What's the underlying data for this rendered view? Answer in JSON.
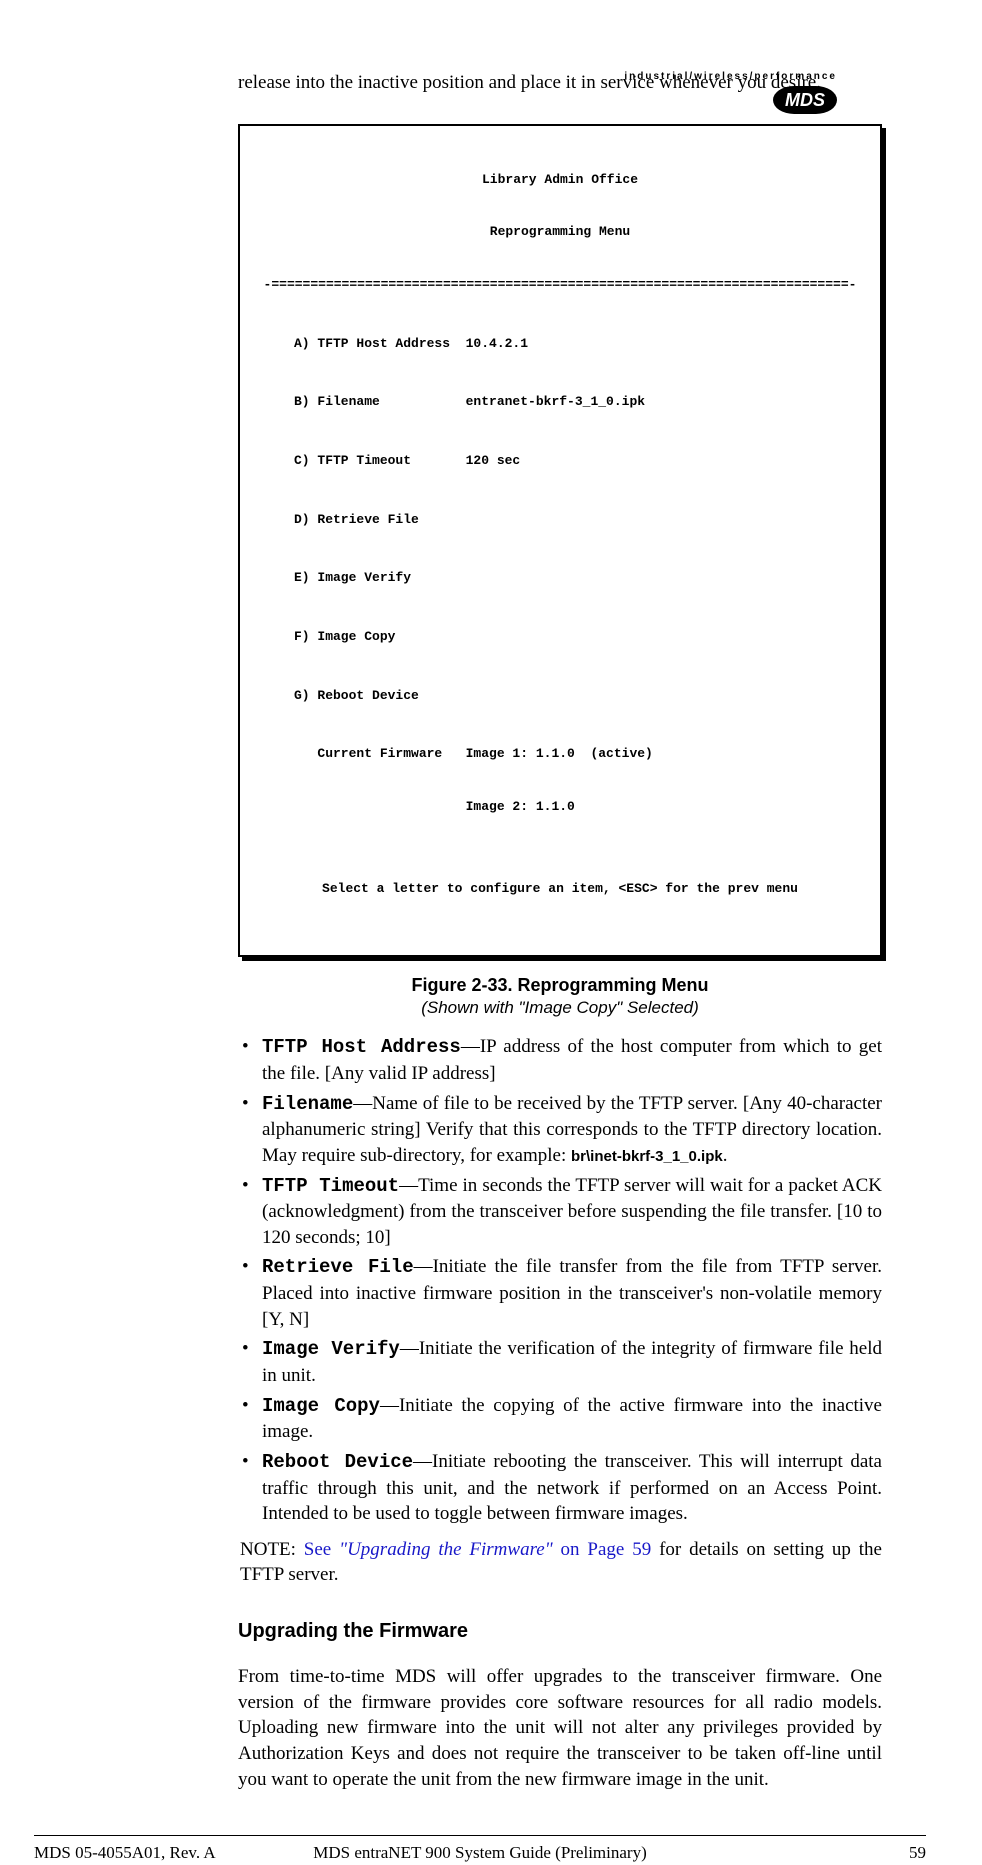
{
  "logo": {
    "tagline": "industrial/wireless/performance",
    "brand": "MDS"
  },
  "intro": "release into the inactive position and place it in service whenever you desire.",
  "terminal": {
    "title1": "Library Admin Office",
    "title2": "Reprogramming Menu",
    "rule": "-==========================================================================-",
    "rows": {
      "a": "A) TFTP Host Address  10.4.2.1",
      "b": "B) Filename           entranet-bkrf-3_1_0.ipk",
      "c": "C) TFTP Timeout       120 sec",
      "d": "D) Retrieve File",
      "e": "E) Image Verify",
      "f": "F) Image Copy",
      "g": "G) Reboot Device",
      "cf1": "   Current Firmware   Image 1: 1.1.0  (active)",
      "cf2": "                      Image 2: 1.1.0"
    },
    "prompt": "Select a letter to configure an item, <ESC> for the prev menu"
  },
  "figure": {
    "main": "Figure 2-33. Reprogramming Menu",
    "sub": "(Shown with \"Image Copy\" Selected)"
  },
  "items": {
    "tftp_host": {
      "term": "TFTP Host Address",
      "desc": "—IP address of the host computer from which to get the file. [Any valid IP address]"
    },
    "filename": {
      "term": "Filename",
      "desc1": "—Name of file to be received by the TFTP server. [Any 40-character alphanumeric string] Verify that this corresponds to the TFTP directory location. May require sub-directory, for example: ",
      "example": "br\\inet-bkrf-3_1_0.ipk",
      "desc2": "."
    },
    "timeout": {
      "term": "TFTP Timeout",
      "desc": "—Time in seconds the TFTP server will wait for a packet ACK (acknowledgment) from the transceiver before suspending the file transfer. [10 to 120 seconds; 10]"
    },
    "retrieve": {
      "term": "Retrieve File",
      "desc": "—Initiate the file transfer from the file from TFTP server. Placed into inactive firmware position in the transceiver's non-volatile memory [Y, N]"
    },
    "verify": {
      "term": "Image Verify",
      "desc": "—Initiate the verification of the integrity of firmware file held in unit."
    },
    "copy": {
      "term": "Image Copy",
      "desc": "—Initiate the copying of the active firmware into the inactive image."
    },
    "reboot": {
      "term": "Reboot Device",
      "desc": "—Initiate rebooting the transceiver. This will interrupt data traffic through this unit, and the network if performed on an Access Point. Intended to be used to toggle between firmware images."
    }
  },
  "note": {
    "prefix": "NOTE: ",
    "link_pre": "See ",
    "link_title": "\"Upgrading the Firmware\"",
    "link_post": " on Page 59",
    "rest": " for details on setting up the TFTP server."
  },
  "section_heading": "Upgrading the Firmware",
  "section_body": "From time-to-time MDS will offer upgrades to the transceiver firmware. One version of the firmware provides core software resources for all radio models. Uploading new firmware into the unit will not alter any privileges provided by Authorization Keys and does not require the transceiver to be taken off-line until you want to operate the unit from the new firmware image in the unit.",
  "footer": {
    "left": "MDS 05-4055A01, Rev. A",
    "center": "MDS entraNET 900 System Guide (Preliminary)",
    "right": "59"
  }
}
